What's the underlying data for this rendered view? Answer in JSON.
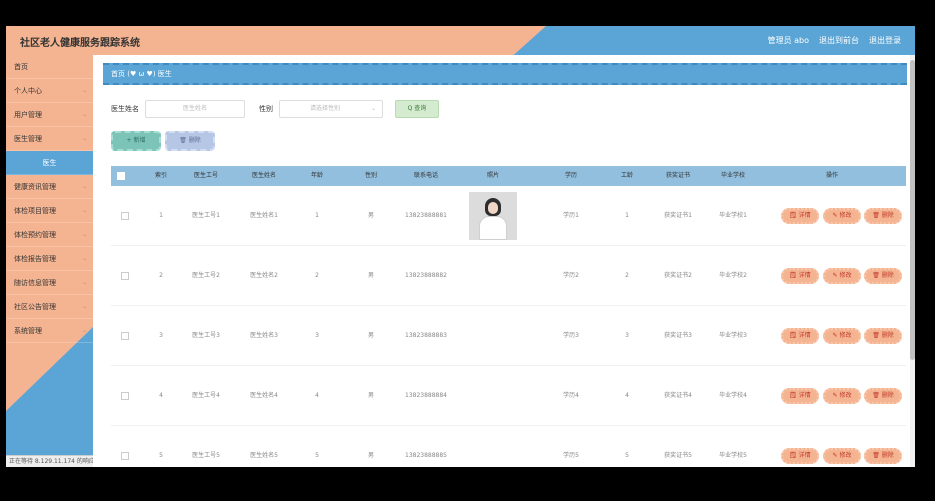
{
  "app": {
    "title": "社区老人健康服务跟踪系统",
    "links": [
      "管理员 abo",
      "退出到前台",
      "退出登录"
    ]
  },
  "sidebar": {
    "items": [
      {
        "label": "首页",
        "chev": false
      },
      {
        "label": "个人中心",
        "chev": true
      },
      {
        "label": "用户管理",
        "chev": true
      },
      {
        "label": "医生管理",
        "chev": true
      },
      {
        "label": "医生",
        "sub": true
      },
      {
        "label": "健康资讯管理",
        "chev": true
      },
      {
        "label": "体检项目管理",
        "chev": true
      },
      {
        "label": "体检预约管理",
        "chev": true
      },
      {
        "label": "体检报告管理",
        "chev": true
      },
      {
        "label": "随访信息管理",
        "chev": true
      },
      {
        "label": "社区公告管理",
        "chev": true
      },
      {
        "label": "系统管理",
        "chev": true
      }
    ]
  },
  "status_text": "正在等待 8.129.11.174 的响应...",
  "breadcrumb": {
    "home": "首页",
    "sep": "(♥ ω ♥)",
    "current": "医生"
  },
  "search": {
    "name_label": "医生姓名",
    "name_placeholder": "医生姓名",
    "gender_label": "性别",
    "gender_placeholder": "请选择性别",
    "query_btn": "Q 查询"
  },
  "actions": {
    "add": "+ 新增",
    "delete": "🗑 删除"
  },
  "table": {
    "headers": [
      "索引",
      "医生工号",
      "医生姓名",
      "年龄",
      "性别",
      "联系电话",
      "照片",
      "学历",
      "工龄",
      "获奖证书",
      "毕业学校",
      "操作"
    ],
    "rows": [
      {
        "index": "1",
        "no": "医生工号1",
        "name": "医生姓名1",
        "age": "1",
        "gender": "男",
        "phone": "13823888881",
        "photo": true,
        "edu": "学历1",
        "years": "1",
        "cert": "获奖证书1",
        "school": "毕业学校1"
      },
      {
        "index": "2",
        "no": "医生工号2",
        "name": "医生姓名2",
        "age": "2",
        "gender": "男",
        "phone": "13823888882",
        "photo": false,
        "edu": "学历2",
        "years": "2",
        "cert": "获奖证书2",
        "school": "毕业学校2"
      },
      {
        "index": "3",
        "no": "医生工号3",
        "name": "医生姓名3",
        "age": "3",
        "gender": "男",
        "phone": "13823888883",
        "photo": false,
        "edu": "学历3",
        "years": "3",
        "cert": "获奖证书3",
        "school": "毕业学校3"
      },
      {
        "index": "4",
        "no": "医生工号4",
        "name": "医生姓名4",
        "age": "4",
        "gender": "男",
        "phone": "13823888884",
        "photo": false,
        "edu": "学历4",
        "years": "4",
        "cert": "获奖证书4",
        "school": "毕业学校4"
      },
      {
        "index": "5",
        "no": "医生工号5",
        "name": "医生姓名5",
        "age": "5",
        "gender": "男",
        "phone": "13823888885",
        "photo": false,
        "edu": "学历5",
        "years": "5",
        "cert": "获奖证书5",
        "school": "毕业学校5"
      }
    ],
    "ops": {
      "detail": "🗒 详情",
      "edit": "✎ 修改",
      "delete": "🗑 删除"
    }
  },
  "colors": {
    "peach": "#f5b491",
    "blue": "#5aa5d6",
    "header": "#92bfde"
  }
}
